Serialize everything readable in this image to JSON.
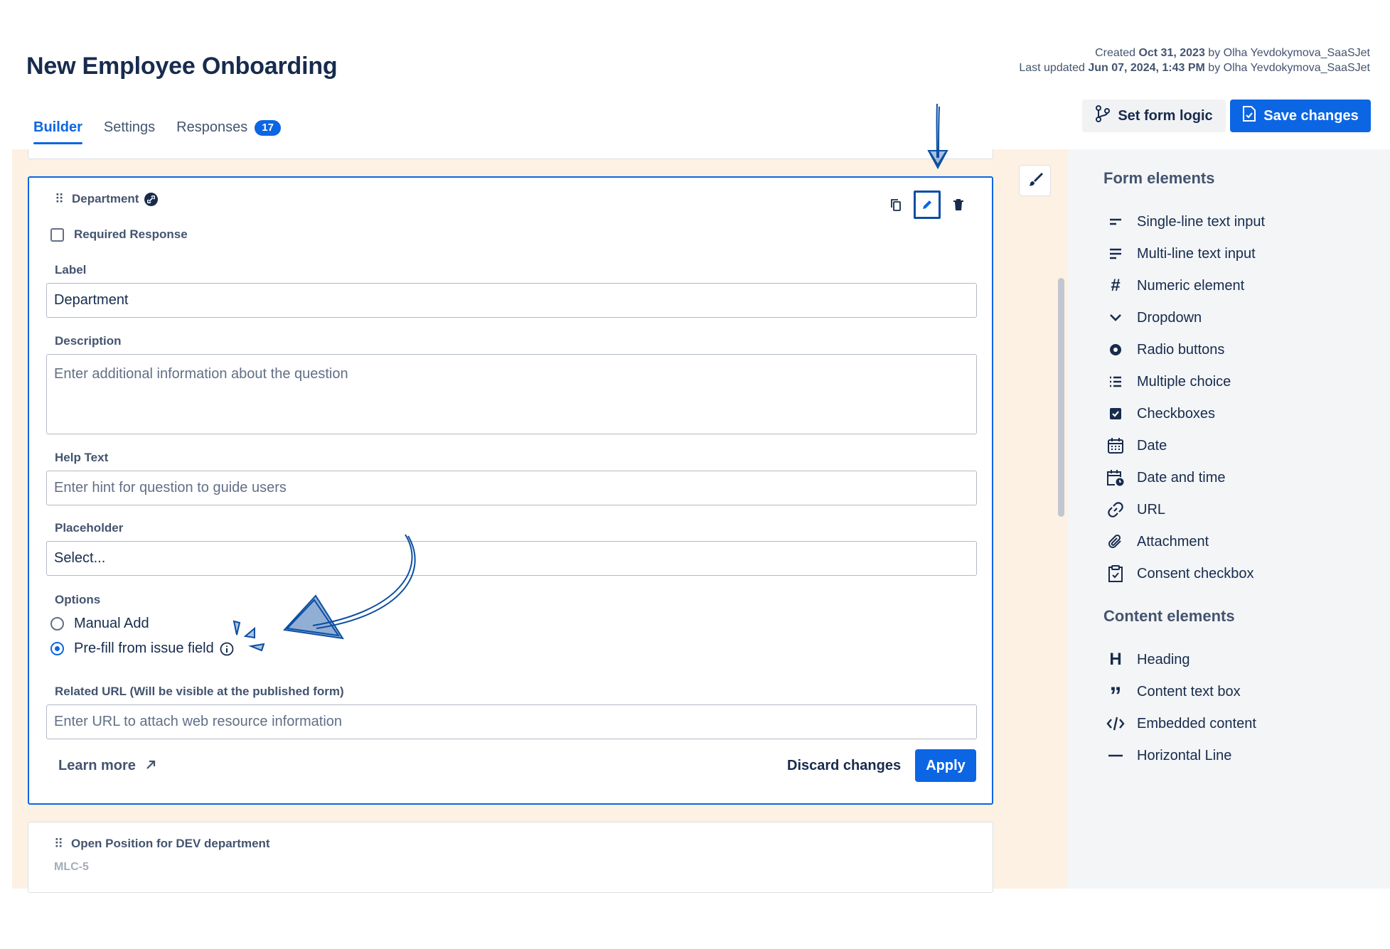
{
  "page": {
    "title": "New Employee Onboarding",
    "created_prefix": "Created ",
    "created_date": "Oct 31, 2023",
    "created_by": " by Olha Yevdokymova_SaaSJet",
    "updated_prefix": "Last updated ",
    "updated_date": "Jun 07, 2024, 1:43 PM",
    "updated_by": " by Olha Yevdokymova_SaaSJet"
  },
  "tabs": [
    {
      "label": "Builder",
      "active": true
    },
    {
      "label": "Settings",
      "active": false
    },
    {
      "label": "Responses",
      "active": false,
      "badge": "17"
    }
  ],
  "toolbar": {
    "logic_label": "Set form logic",
    "save_label": "Save changes"
  },
  "editor": {
    "title": "Department",
    "required_label": "Required Response",
    "label_label": "Label",
    "label_value": "Department",
    "description_label": "Description",
    "description_placeholder": "Enter additional information about the question",
    "help_label": "Help Text",
    "help_placeholder": "Enter hint for question to guide users",
    "placeholder_label": "Placeholder",
    "placeholder_value": "Select...",
    "options_label": "Options",
    "option_manual": "Manual Add",
    "option_prefill": "Pre-fill from issue field",
    "option_selected": "Pre-fill from issue field",
    "related_url_label": "Related URL (Will be visible at the published form)",
    "related_url_placeholder": "Enter URL to attach web resource information",
    "learn_more": "Learn more",
    "discard": "Discard changes",
    "apply": "Apply"
  },
  "next_card": {
    "title": "Open Position for DEV department",
    "key": "MLC-5"
  },
  "sidebar": {
    "form_heading": "Form elements",
    "form_items": [
      {
        "label": "Single-line text input",
        "icon": "short-text-icon"
      },
      {
        "label": "Multi-line text input",
        "icon": "long-text-icon"
      },
      {
        "label": "Numeric element",
        "icon": "hash-icon"
      },
      {
        "label": "Dropdown",
        "icon": "chevron-down-icon"
      },
      {
        "label": "Radio buttons",
        "icon": "radio-icon"
      },
      {
        "label": "Multiple choice",
        "icon": "list-icon"
      },
      {
        "label": "Checkboxes",
        "icon": "checkbox-icon"
      },
      {
        "label": "Date",
        "icon": "calendar-icon"
      },
      {
        "label": "Date and time",
        "icon": "calendar-clock-icon"
      },
      {
        "label": "URL",
        "icon": "link-icon"
      },
      {
        "label": "Attachment",
        "icon": "paperclip-icon"
      },
      {
        "label": "Consent checkbox",
        "icon": "clipboard-check-icon"
      }
    ],
    "content_heading": "Content elements",
    "content_items": [
      {
        "label": "Heading",
        "icon": "heading-icon"
      },
      {
        "label": "Content text box",
        "icon": "quote-icon"
      },
      {
        "label": "Embedded content",
        "icon": "code-icon"
      },
      {
        "label": "Horizontal Line",
        "icon": "horizontal-line-icon"
      }
    ]
  },
  "colors": {
    "accent": "#0c66e4",
    "canvas": "#fdf1e3",
    "sidebar": "#f4f5f7",
    "text": "#172b4d",
    "annotation": "#0b4ea2"
  }
}
